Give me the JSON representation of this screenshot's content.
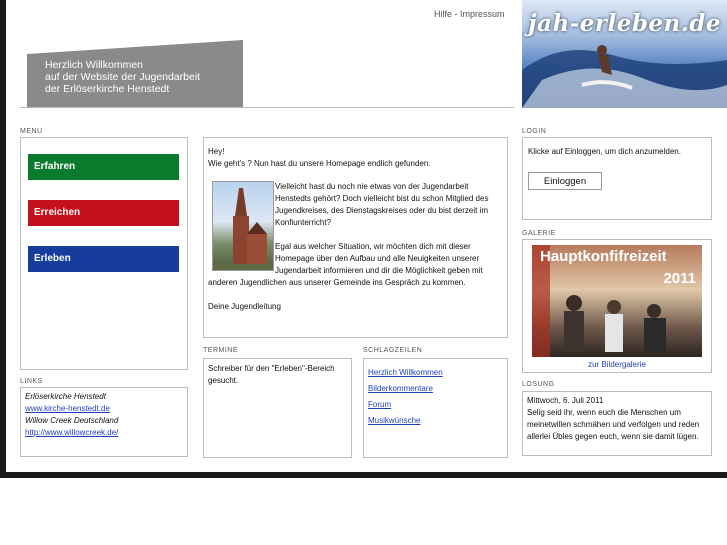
{
  "header": {
    "help": "Hilfe",
    "separator": "-",
    "imprint": "Impressum",
    "welcome_line1": "Herzlich Willkommen",
    "welcome_line2": "auf der Website der Jugendarbeit",
    "welcome_line3": "der Erlöserkirche Henstedt",
    "banner_logo": "jah-erleben.de"
  },
  "menu": {
    "title": "MENU",
    "items": [
      {
        "label": "Erfahren",
        "color": "#0a7a2c"
      },
      {
        "label": "Erreichen",
        "color": "#c4101e"
      },
      {
        "label": "Erleben",
        "color": "#173d9c"
      }
    ]
  },
  "links": {
    "title": "LINKS",
    "org1": "Erlöserkirche Henstedt",
    "url1": "www.kirche-henstedt.de",
    "org2": "Willow Creek Deutschland",
    "url2": "http://www.willowcreek.de/"
  },
  "main": {
    "line1": "Hey!",
    "line2": "Wie geht's ? Nun hast du unsere Homepage endlich gefunden.",
    "para1": "Vielleicht hast du noch nie etwas von der Jugendarbeit Henstedts gehört? Doch vielleicht bist du schon Mitglied des Jugendkreises, des Dienstagskreises oder du bist derzeit im Konfiunterricht?",
    "para2_a": "Egal aus welcher Situation, wir möchten dich mit dieser Homepage über den Aufbau und alle Neuigkeiten unserer Jugendarbeit informieren und dir die Möglichkeit geben mit",
    "para2_b": "anderen Jugendlichen aus unserer Gemeinde ins Gespräch zu kommen.",
    "sign": "Deine Jugendleitung"
  },
  "termine": {
    "title": "TERMINE",
    "text": "Schreiber für den \"Erleben\"-Bereich gesucht."
  },
  "schlagzeilen": {
    "title": "SCHLAGZEILEN",
    "items": [
      "Herzlich Willkommen",
      "Bilderkommentare",
      "Forum",
      "Musikwünsche"
    ]
  },
  "login": {
    "title": "LOGIN",
    "hint": "Klicke auf Einloggen, um dich anzumelden.",
    "button": "Einloggen"
  },
  "galerie": {
    "title": "GALERIE",
    "image_text1": "Hauptkonfifreizeit",
    "image_text2": "2011",
    "link": "zur Bildergalerie"
  },
  "losung": {
    "title": "LOSUNG",
    "date": "Mittwoch, 6. Juli 2011",
    "text": "Selig seid ihr, wenn euch die Menschen um meinetwillen schmähen und verfolgen und reden allerlei Übles gegen euch, wenn sie damit lügen."
  }
}
